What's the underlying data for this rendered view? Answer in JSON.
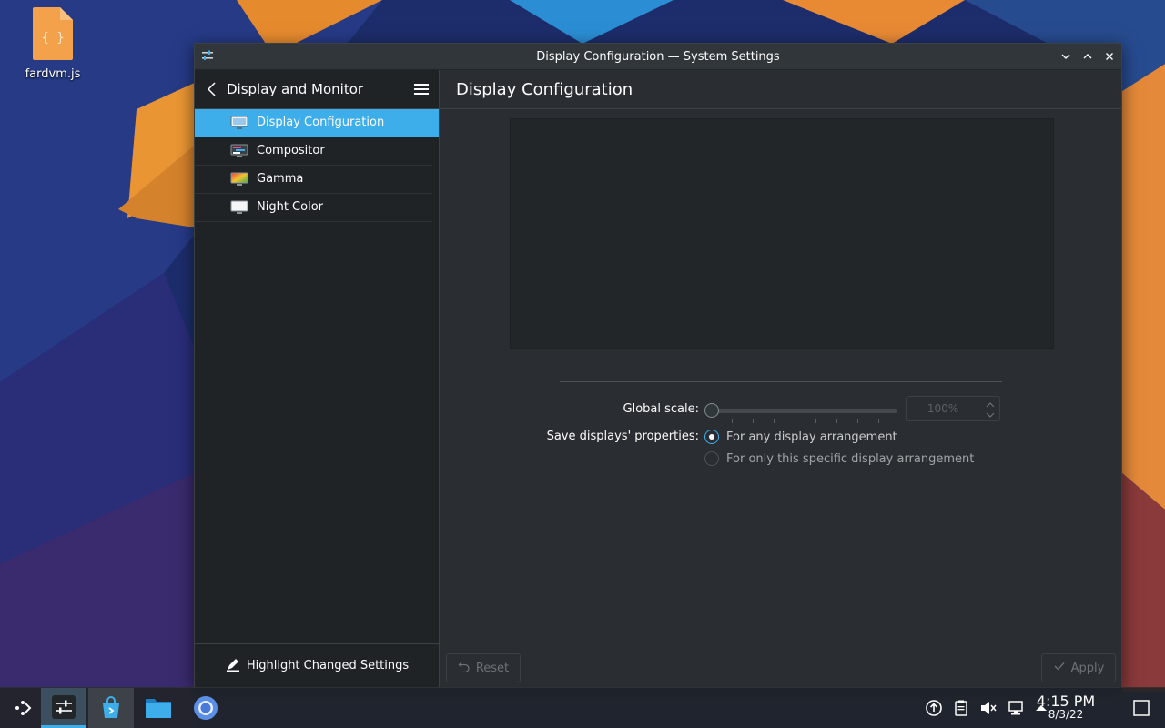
{
  "desktop": {
    "file_icon_label": "fardvm.js",
    "file_icon_glyph": "{ }"
  },
  "window": {
    "title": "Display Configuration — System Settings",
    "controls": [
      "minimize-icon",
      "maximize-icon",
      "close-icon"
    ]
  },
  "sidebar": {
    "title": "Display and Monitor",
    "items": [
      {
        "label": "Display Configuration",
        "icon": "monitor-icon",
        "active": true
      },
      {
        "label": "Compositor",
        "icon": "compositor-icon",
        "active": false
      },
      {
        "label": "Gamma",
        "icon": "gamma-icon",
        "active": false
      },
      {
        "label": "Night Color",
        "icon": "night-color-icon",
        "active": false
      }
    ],
    "footer_label": "Highlight Changed Settings"
  },
  "main": {
    "title": "Display Configuration",
    "global_scale_label": "Global scale:",
    "global_scale_value": "100%",
    "global_scale_fraction": 0.0,
    "save_props_label": "Save displays' properties:",
    "radio_options": [
      {
        "label": "For any display arrangement",
        "selected": true
      },
      {
        "label": "For only this specific display arrangement",
        "selected": false
      }
    ],
    "reset_label": "Reset",
    "apply_label": "Apply"
  },
  "taskbar": {
    "apps": [
      "launcher-icon",
      "system-settings-icon",
      "discover-store-icon",
      "file-manager-icon",
      "chromium-icon"
    ],
    "tray": [
      "update-icon",
      "clipboard-icon",
      "volume-muted-icon",
      "network-icon",
      "expand-tray-icon"
    ],
    "time": "4:15 PM",
    "date": "8/3/22"
  },
  "colors": {
    "accent": "#3daee9",
    "window_bg": "#2a2e32",
    "sidebar_bg": "#202326",
    "file_orange": "#f4a14c"
  }
}
